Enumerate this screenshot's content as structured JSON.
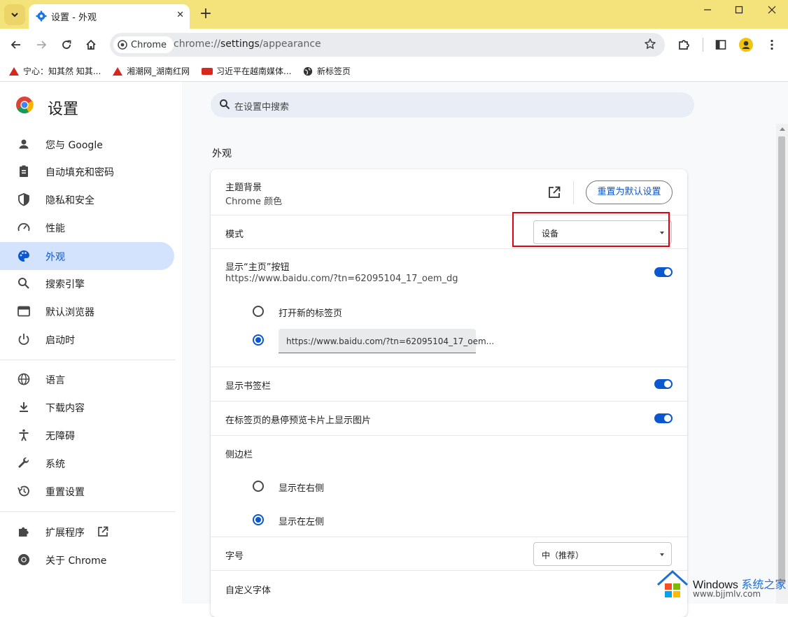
{
  "tab": {
    "title": "设置 - 外观"
  },
  "omnibox": {
    "chip": "Chrome",
    "url_scheme": "chrome://",
    "url_host": "settings",
    "url_path": "/appearance"
  },
  "bookmarks": [
    {
      "label": "宁心：知其然 知其..."
    },
    {
      "label": "湘潮网_湖南红网"
    },
    {
      "label": "习近平在越南媒体..."
    },
    {
      "label": "新标签页"
    }
  ],
  "sidebar": {
    "title": "设置",
    "items": [
      {
        "label": "您与 Google",
        "icon": "person-icon"
      },
      {
        "label": "自动填充和密码",
        "icon": "clipboard-icon"
      },
      {
        "label": "隐私和安全",
        "icon": "shield-icon"
      },
      {
        "label": "性能",
        "icon": "speedometer-icon"
      },
      {
        "label": "外观",
        "icon": "palette-icon",
        "active": true
      },
      {
        "label": "搜索引擎",
        "icon": "search-icon"
      },
      {
        "label": "默认浏览器",
        "icon": "browser-icon"
      },
      {
        "label": "启动时",
        "icon": "power-icon"
      },
      {
        "label": "语言",
        "icon": "globe-icon"
      },
      {
        "label": "下载内容",
        "icon": "download-icon"
      },
      {
        "label": "无障碍",
        "icon": "accessibility-icon"
      },
      {
        "label": "系统",
        "icon": "wrench-icon"
      },
      {
        "label": "重置设置",
        "icon": "history-icon"
      },
      {
        "label": "扩展程序",
        "icon": "puzzle-icon"
      },
      {
        "label": "关于 Chrome",
        "icon": "chrome-icon"
      }
    ]
  },
  "search": {
    "placeholder": "在设置中搜索"
  },
  "section": {
    "title": "外观"
  },
  "appearance": {
    "theme_label": "主题背景",
    "theme_value": "Chrome 颜色",
    "reset_button": "重置为默认设置",
    "mode_label": "模式",
    "mode_value": "设备",
    "home_label": "显示“主页”按钮",
    "home_url": "https://www.baidu.com/?tn=62095104_17_oem_dg",
    "home_toggle_on": true,
    "home_option_newtab": "打开新的标签页",
    "home_option_url_value": "https://www.baidu.com/?tn=62095104_17_oem...",
    "bookmarks_bar_label": "显示书签栏",
    "bookmarks_bar_on": true,
    "hover_preview_label": "在标签页的悬停预览卡片上显示图片",
    "hover_preview_on": true,
    "side_panel_label": "侧边栏",
    "side_panel_right": "显示在右侧",
    "side_panel_left": "显示在左侧",
    "font_size_label": "字号",
    "font_size_value": "中（推荐）",
    "custom_fonts_label": "自定义字体"
  },
  "watermark": {
    "brand": "Windows",
    "suffix": "系统之家",
    "url": "www.bjjmlv.com"
  },
  "colors": {
    "titlebar": "#f4e27a",
    "accent": "#0b57d0",
    "active_nav": "#d3e3fd",
    "highlight_box": "#e3000f"
  }
}
